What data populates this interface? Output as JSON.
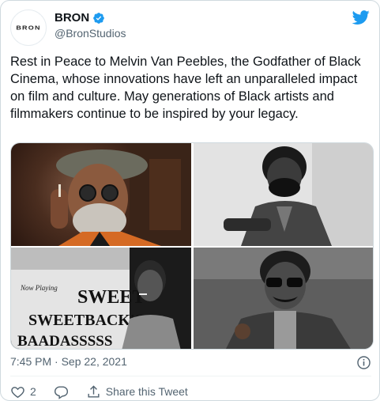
{
  "author": {
    "display_name": "BRON",
    "handle": "@BronStudios",
    "avatar_text": "BRON",
    "verified": true
  },
  "tweet": {
    "text": "Rest in Peace to Melvin Van Peebles, the Godfather of Black Cinema, whose innovations have left an unparalleled impact on film and culture. May generations of Black artists and filmmakers continue to be inspired by your legacy.",
    "timestamp": "7:45 PM · Sep 22, 2021"
  },
  "actions": {
    "like_count": "2",
    "share_label": "Share this Tweet"
  },
  "media": {
    "poster_text": [
      "Now Playing",
      "SWEET",
      "SWEETBACK'S",
      "BAADASSSSS"
    ]
  },
  "colors": {
    "twitter_blue": "#1d9bf0",
    "text_primary": "#0f1419",
    "text_secondary": "#536471",
    "border": "#cfd9de"
  }
}
